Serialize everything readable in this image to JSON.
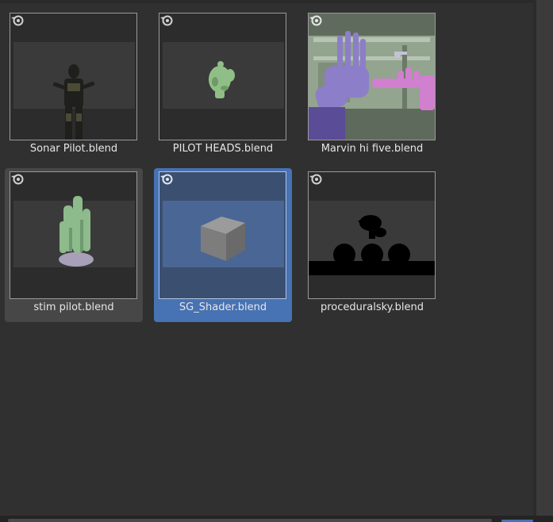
{
  "files": [
    {
      "name": "Sonar Pilot.blend",
      "state": "normal",
      "icon": "soldier-figure-thumbnail"
    },
    {
      "name": "PILOT HEADS.blend",
      "state": "normal",
      "icon": "green-head-thumbnail"
    },
    {
      "name": "Marvin hi five.blend",
      "state": "normal",
      "icon": "robot-hand-thumbnail"
    },
    {
      "name": "stim pilot.blend",
      "state": "hover",
      "icon": "green-crystal-thumbnail"
    },
    {
      "name": "SG_Shader.blend",
      "state": "selected",
      "icon": "cube-thumbnail"
    },
    {
      "name": "proceduralsky.blend",
      "state": "normal",
      "icon": "silhouette-thumbnail"
    }
  ],
  "colors": {
    "background": "#303030",
    "selected": "#4772b3",
    "hover": "#474747",
    "text": "#e6e6e6"
  },
  "file_type_icon": "blender-icon"
}
